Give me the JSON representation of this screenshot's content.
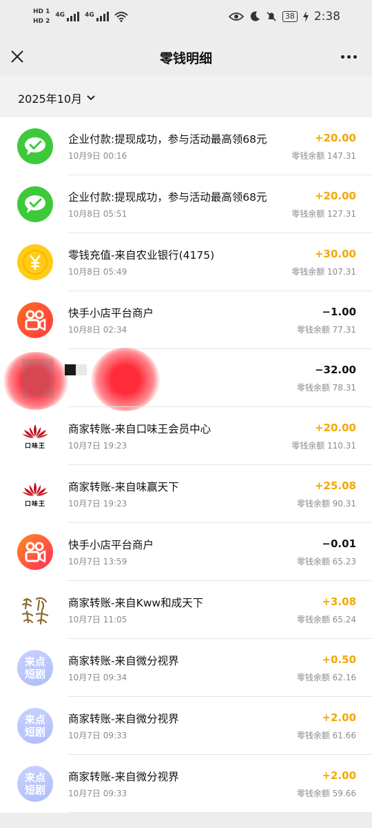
{
  "status_bar": {
    "hd1": "HD 1",
    "hd2": "HD 2",
    "net1": "4G",
    "net2": "4G",
    "battery": "38",
    "time": "2:38"
  },
  "nav": {
    "title": "零钱明细"
  },
  "month_filter": {
    "label": "2025年10月"
  },
  "transactions": [
    {
      "icon": "wechat-icon",
      "title": "企业付款:提现成功，参与活动最高领68元",
      "time": "10月9日 00:16",
      "amount": "+20.00",
      "balance": "零钱余额 147.31"
    },
    {
      "icon": "wechat-icon",
      "title": "企业付款:提现成功，参与活动最高领68元",
      "time": "10月8日 05:51",
      "amount": "+20.00",
      "balance": "零钱余额 127.31"
    },
    {
      "icon": "yuan-coin-icon",
      "title": "零钱充值-来自农业银行(4175)",
      "time": "10月8日 05:49",
      "amount": "+30.00",
      "balance": "零钱余额 107.31"
    },
    {
      "icon": "kuaishou-icon",
      "title": "快手小店平台商户",
      "time": "10月8日 02:34",
      "amount": "−1.00",
      "balance": "零钱余额 77.31"
    },
    {
      "icon": "blurred-avatar",
      "title": "",
      "time": "",
      "amount": "−32.00",
      "balance": "零钱余额 78.31"
    },
    {
      "icon": "lotus-logo-icon",
      "title": "商家转账-来自口味王会员中心",
      "time": "10月7日 19:23",
      "amount": "+20.00",
      "balance": "零钱余额 110.31"
    },
    {
      "icon": "lotus-logo-icon",
      "title": "商家转账-来自味赢天下",
      "time": "10月7日 19:23",
      "amount": "+25.08",
      "balance": "零钱余额 90.31"
    },
    {
      "icon": "kuaishou-icon",
      "title": "快手小店平台商户",
      "time": "10月7日 13:59",
      "amount": "−0.01",
      "balance": "零钱余额 65.23"
    },
    {
      "icon": "calligraphy-logo-icon",
      "title": "商家转账-来自Kww和成天下",
      "time": "10月7日 11:05",
      "amount": "+3.08",
      "balance": "零钱余额 65.24"
    },
    {
      "icon": "laidian-duanju-icon",
      "title": "商家转账-来自微分视界",
      "time": "10月7日 09:34",
      "amount": "+0.50",
      "balance": "零钱余额 62.16"
    },
    {
      "icon": "laidian-duanju-icon",
      "title": "商家转账-来自微分视界",
      "time": "10月7日 09:33",
      "amount": "+2.00",
      "balance": "零钱余额 61.66"
    },
    {
      "icon": "laidian-duanju-icon",
      "title": "商家转账-来自微分视界",
      "time": "10月7日 09:33",
      "amount": "+2.00",
      "balance": "零钱余额 59.66"
    }
  ],
  "logos": {
    "lotus_text": "口味王",
    "laidian_line1": "来点",
    "laidian_line2": "短剧",
    "calligraphy": "和成天下"
  },
  "colors": {
    "positive": "#f0a800",
    "negative": "#111111",
    "wechat_green": "#3dc93a"
  }
}
